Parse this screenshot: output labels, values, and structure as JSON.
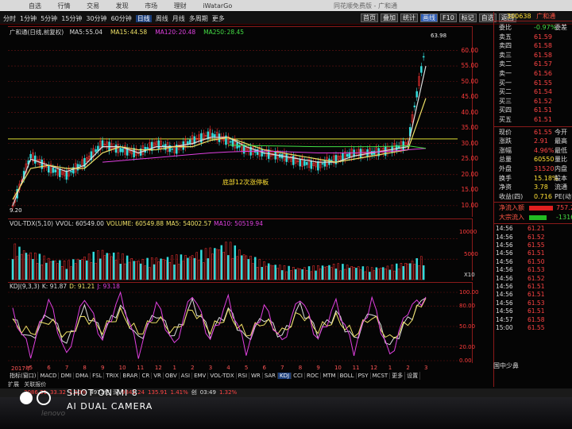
{
  "menu": {
    "items": [
      "自选",
      "行情",
      "交易",
      "发现",
      "市场",
      "理财",
      "iWatarGo"
    ],
    "title": "同花顺免费版 - 广和通"
  },
  "period_tabs": [
    "分时",
    "1分钟",
    "5分钟",
    "15分钟",
    "30分钟",
    "60分钟",
    "日线",
    "周线",
    "月线",
    "多周期",
    "更多"
  ],
  "period_active": "日线",
  "right_tools": [
    "首页",
    "叠加",
    "统计",
    "画线",
    "F10",
    "标记",
    "自选",
    "返回"
  ],
  "right_tools_active": "画线",
  "main_chart": {
    "title": "广和通(日线,前复权)",
    "ma": [
      {
        "label": "MA5:",
        "value": "55.04",
        "color": "#dddddd"
      },
      {
        "label": "MA15:",
        "value": "44.58",
        "color": "#eee066"
      },
      {
        "label": "MA120:",
        "value": "20.48",
        "color": "#e040e0"
      },
      {
        "label": "MA250:",
        "value": "28.45",
        "color": "#44dd44"
      }
    ],
    "high_label": "63.98",
    "low_label": "9.20",
    "annotation": "底部12次涨停板",
    "price_ticks": [
      "60.00",
      "55.00",
      "50.00",
      "45.00",
      "40.00",
      "35.00",
      "30.00",
      "25.00",
      "20.00",
      "15.00",
      "10.00"
    ]
  },
  "vol_chart": {
    "legend": [
      {
        "text": "VOL-TDX(5,10)",
        "color": "#dddddd"
      },
      {
        "text": "VVOL: 60549.00",
        "color": "#dddddd"
      },
      {
        "text": "VOLUME: 60549.88",
        "color": "#eee066"
      },
      {
        "text": "MA5: 54002.57",
        "color": "#eee066"
      },
      {
        "text": "MA10: 50519.94",
        "color": "#e040e0"
      }
    ],
    "ticks": [
      "10000",
      "5000"
    ],
    "unit": "X10"
  },
  "kdj_chart": {
    "legend": [
      {
        "text": "KDJ(9,3,3)",
        "color": "#dddddd"
      },
      {
        "text": "K: 91.87",
        "color": "#dddddd"
      },
      {
        "text": "D: 91.21",
        "color": "#eee066"
      },
      {
        "text": "J: 93.18",
        "color": "#e040e0"
      }
    ],
    "ticks": [
      "100.00",
      "80.00",
      "50.00",
      "20.00",
      "0.00"
    ]
  },
  "date_axis": [
    "2017年",
    "5",
    "6",
    "7",
    "8",
    "9",
    "10",
    "11",
    "12",
    "1",
    "2",
    "3",
    "4",
    "5",
    "6",
    "7",
    "8",
    "9",
    "10",
    "11",
    "12",
    "1",
    "2",
    "3"
  ],
  "indicator_tabs": [
    "指标(窗口)",
    "MACD",
    "DMI",
    "DMA",
    "FSL",
    "TRIX",
    "BRAR",
    "CR",
    "VR",
    "OBV",
    "ASI",
    "EMV",
    "VOL-TDX",
    "RSI",
    "WR",
    "SAR",
    "KDJ",
    "CCI",
    "ROC",
    "MTM",
    "BOLL",
    "PSY",
    "MCST",
    "更多",
    "设置"
  ],
  "indicator_active": "KDJ",
  "sub_tabs": [
    "扩展",
    "关联报价"
  ],
  "ticker": [
    {
      "text": "3086.31",
      "color": "#ff4444"
    },
    {
      "text": "33.32",
      "color": "#ff4444"
    },
    {
      "text": "1.10%",
      "color": "#ff4444"
    },
    {
      "text": "4971亿",
      "color": "#dddddd"
    },
    {
      "text": "深",
      "color": "#dddddd"
    },
    {
      "text": "9841.24",
      "color": "#ff4444"
    },
    {
      "text": "135.91",
      "color": "#ff4444"
    },
    {
      "text": "1.41%",
      "color": "#ff4444"
    },
    {
      "text": "创",
      "color": "#dddddd"
    },
    {
      "text": "03:49",
      "color": "#dddddd"
    },
    {
      "text": "1.32%",
      "color": "#ff4444"
    }
  ],
  "side": {
    "code": "300638",
    "name": "广和通",
    "order_book": [
      {
        "label": "委比",
        "value": "-0.97%",
        "r": "委差",
        "color": "#44dd44"
      },
      {
        "label": "卖五",
        "value": "61.59",
        "r": "",
        "color": "#ff4444"
      },
      {
        "label": "卖四",
        "value": "61.58",
        "r": "",
        "color": "#ff4444"
      },
      {
        "label": "卖三",
        "value": "61.58",
        "r": "",
        "color": "#ff4444"
      },
      {
        "label": "卖二",
        "value": "61.57",
        "r": "",
        "color": "#ff4444"
      },
      {
        "label": "卖一",
        "value": "61.56",
        "r": "",
        "color": "#ff4444"
      },
      {
        "label": "买一",
        "value": "61.55",
        "r": "",
        "color": "#ff4444"
      },
      {
        "label": "买二",
        "value": "61.54",
        "r": "",
        "color": "#ff4444"
      },
      {
        "label": "买三",
        "value": "61.52",
        "r": "",
        "color": "#ff4444"
      },
      {
        "label": "买四",
        "value": "61.51",
        "r": "",
        "color": "#ff4444"
      },
      {
        "label": "买五",
        "value": "61.51",
        "r": "",
        "color": "#ff4444"
      }
    ],
    "quote": [
      {
        "label": "现价",
        "value": "61.55",
        "r": "今开",
        "color": "#ff4444"
      },
      {
        "label": "涨跌",
        "value": "2.91",
        "r": "最高",
        "color": "#ff4444"
      },
      {
        "label": "涨幅",
        "value": "4.96%",
        "r": "最低",
        "color": "#ff4444"
      },
      {
        "label": "总量",
        "value": "60550",
        "r": "量比",
        "color": "#ffe033"
      },
      {
        "label": "外盘",
        "value": "31520",
        "r": "内盘",
        "color": "#ff4444"
      },
      {
        "label": "换手",
        "value": "15.18%",
        "r": "股本",
        "color": "#ffe033"
      },
      {
        "label": "净资",
        "value": "3.78",
        "r": "流通",
        "color": "#ffe033"
      },
      {
        "label": "收益(四)",
        "value": "0.716",
        "r": "PE(动)",
        "color": "#ffe033"
      }
    ],
    "flow": [
      {
        "label": "净流入额",
        "value": "757.2",
        "color": "#ff4444",
        "bar_color": "#e02020",
        "bar_w": 30
      },
      {
        "label": "大宗流入",
        "value": "-1316",
        "color": "#44dd44",
        "bar_color": "#22bb22",
        "bar_w": 22
      }
    ],
    "ticks": [
      {
        "time": "14:56",
        "price": "61.21",
        "color": "#ff4444"
      },
      {
        "time": "14:56",
        "price": "61.52",
        "color": "#ff4444"
      },
      {
        "time": "14:56",
        "price": "61.55",
        "color": "#ff4444"
      },
      {
        "time": "14:56",
        "price": "61.51",
        "color": "#ff4444"
      },
      {
        "time": "14:56",
        "price": "61.50",
        "color": "#ff4444"
      },
      {
        "time": "14:56",
        "price": "61.53",
        "color": "#ff4444"
      },
      {
        "time": "14:56",
        "price": "61.52",
        "color": "#ff4444"
      },
      {
        "time": "14:56",
        "price": "61.51",
        "color": "#ff4444"
      },
      {
        "time": "14:56",
        "price": "61.51",
        "color": "#ff4444"
      },
      {
        "time": "14:56",
        "price": "61.53",
        "color": "#ff4444"
      },
      {
        "time": "14:56",
        "price": "61.51",
        "color": "#ff4444"
      },
      {
        "time": "14:57",
        "price": "61.58",
        "color": "#ff4444"
      },
      {
        "time": "15:00",
        "price": "61.55",
        "color": "#ff4444"
      }
    ],
    "bottom": "国中少鼻"
  },
  "watermark": {
    "line1": "SHOT ON MI 8",
    "line2": "AI DUAL CAMERA",
    "brand": "lenovo"
  },
  "chart_data": [
    {
      "type": "candlestick",
      "title": "广和通(日线,前复权)",
      "ylim": [
        9.2,
        63.98
      ],
      "x": [
        "2017年",
        "5",
        "6",
        "7",
        "8",
        "9",
        "10",
        "11",
        "12",
        "1",
        "2",
        "3",
        "4",
        "5",
        "6",
        "7",
        "8",
        "9",
        "10",
        "11",
        "12",
        "1",
        "2",
        "3"
      ],
      "close": [
        10,
        26,
        22,
        20,
        24,
        30,
        28,
        27,
        30,
        28,
        31,
        33,
        31,
        28,
        27,
        26,
        24,
        23,
        25,
        27,
        27,
        28,
        30,
        62
      ],
      "series": [
        {
          "name": "MA5",
          "values": [
            10,
            25,
            23,
            21,
            23,
            29,
            29,
            27,
            29,
            29,
            30,
            32,
            32,
            29,
            27,
            26,
            25,
            24,
            24,
            26,
            27,
            28,
            29,
            55
          ]
        },
        {
          "name": "MA15",
          "values": [
            12,
            22,
            23,
            22,
            22,
            27,
            29,
            28,
            28,
            29,
            29,
            31,
            32,
            30,
            28,
            27,
            26,
            25,
            24,
            25,
            26,
            27,
            28,
            44.6
          ]
        },
        {
          "name": "MA120",
          "values": [
            null,
            null,
            null,
            null,
            null,
            24,
            24.5,
            25,
            25.5,
            26,
            26.5,
            27,
            27.3,
            27.5,
            27.6,
            27.4,
            27.2,
            27,
            27,
            27,
            27.2,
            27.5,
            28,
            28.45
          ]
        },
        {
          "name": "MA250",
          "values": [
            null,
            null,
            null,
            null,
            null,
            null,
            null,
            null,
            null,
            null,
            null,
            null,
            29.5,
            29.4,
            29.3,
            29.2,
            29.1,
            29,
            29,
            29,
            29,
            29.1,
            29.3,
            28.45
          ]
        }
      ],
      "annotations": [
        "底部12次涨停板",
        "63.98",
        "9.20"
      ]
    },
    {
      "type": "bar",
      "title": "VOL-TDX(5,10)",
      "ylim": [
        0,
        12000
      ],
      "x": [
        "2017年",
        "5",
        "6",
        "7",
        "8",
        "9",
        "10",
        "11",
        "12",
        "1",
        "2",
        "3",
        "4",
        "5",
        "6",
        "7",
        "8",
        "9",
        "10",
        "11",
        "12",
        "1",
        "2",
        "3"
      ],
      "values": [
        9000,
        7000,
        5500,
        4500,
        6000,
        7500,
        6500,
        5000,
        5500,
        6000,
        6500,
        8000,
        9500,
        6500,
        4500,
        3500,
        3000,
        3500,
        4000,
        3500,
        3000,
        3500,
        4500,
        6055
      ]
    },
    {
      "type": "line",
      "title": "KDJ(9,3,3)",
      "ylim": [
        0,
        100
      ],
      "x": [
        "2017年",
        "5",
        "6",
        "7",
        "8",
        "9",
        "10",
        "11",
        "12",
        "1",
        "2",
        "3",
        "4",
        "5",
        "6",
        "7",
        "8",
        "9",
        "10",
        "11",
        "12",
        "1",
        "2",
        "3"
      ],
      "series": [
        {
          "name": "K",
          "values": [
            60,
            30,
            70,
            25,
            75,
            40,
            80,
            30,
            70,
            35,
            85,
            40,
            75,
            30,
            65,
            35,
            80,
            40,
            70,
            30,
            75,
            20,
            60,
            91.87
          ]
        },
        {
          "name": "D",
          "values": [
            55,
            40,
            60,
            35,
            65,
            45,
            70,
            40,
            62,
            42,
            75,
            45,
            68,
            38,
            58,
            40,
            70,
            45,
            62,
            38,
            66,
            30,
            55,
            91.21
          ]
        },
        {
          "name": "J",
          "values": [
            70,
            10,
            90,
            5,
            95,
            30,
            100,
            10,
            85,
            20,
            100,
            30,
            90,
            15,
            80,
            25,
            95,
            30,
            85,
            15,
            90,
            5,
            75,
            93.18
          ]
        }
      ]
    }
  ]
}
